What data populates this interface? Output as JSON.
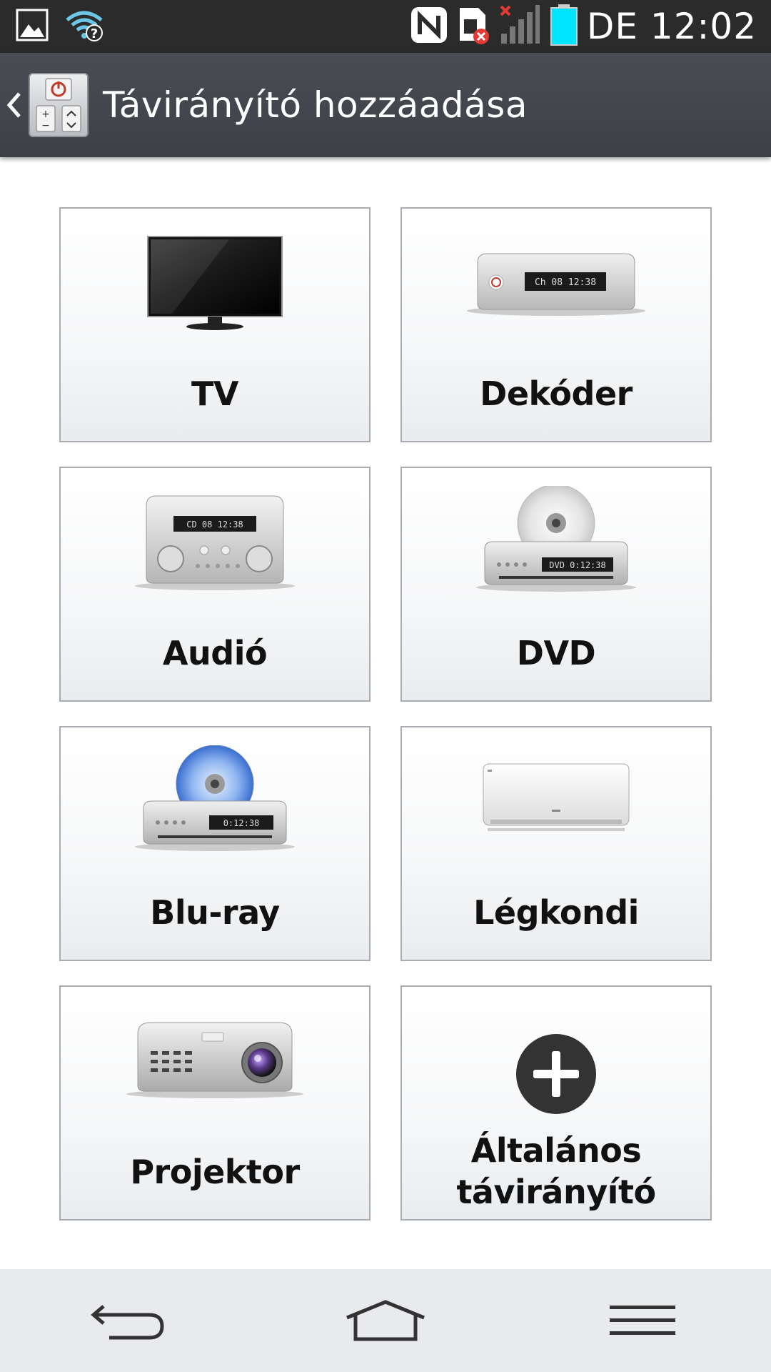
{
  "status_bar": {
    "time": "DE 12:02",
    "icons": [
      "gallery-icon",
      "wifi-unknown-icon",
      "nfc-icon",
      "no-sim-icon",
      "signal-none-icon",
      "battery-icon"
    ],
    "battery_color": "#00e5ff"
  },
  "action_bar": {
    "title": "Távirányító hozzáadása",
    "app_icon": "remote-icon"
  },
  "devices": [
    {
      "label": "TV",
      "icon": "tv-icon"
    },
    {
      "label": "Dekóder",
      "icon": "set-top-box-icon"
    },
    {
      "label": "Audió",
      "icon": "audio-receiver-icon"
    },
    {
      "label": "DVD",
      "icon": "dvd-player-icon"
    },
    {
      "label": "Blu-ray",
      "icon": "bluray-player-icon"
    },
    {
      "label": "Légkondi",
      "icon": "air-conditioner-icon"
    },
    {
      "label": "Projektor",
      "icon": "projector-icon"
    },
    {
      "label": "Általános távirányító",
      "icon": "add-icon"
    }
  ],
  "device_displays": {
    "decoder": "Ch 08   12:38",
    "audio": "CD 08   12:38",
    "dvd": "DVD  0:12:38",
    "bluray": "0:12:38"
  },
  "nav_bar": {
    "buttons": [
      "back-icon",
      "home-icon",
      "menu-icon"
    ]
  }
}
